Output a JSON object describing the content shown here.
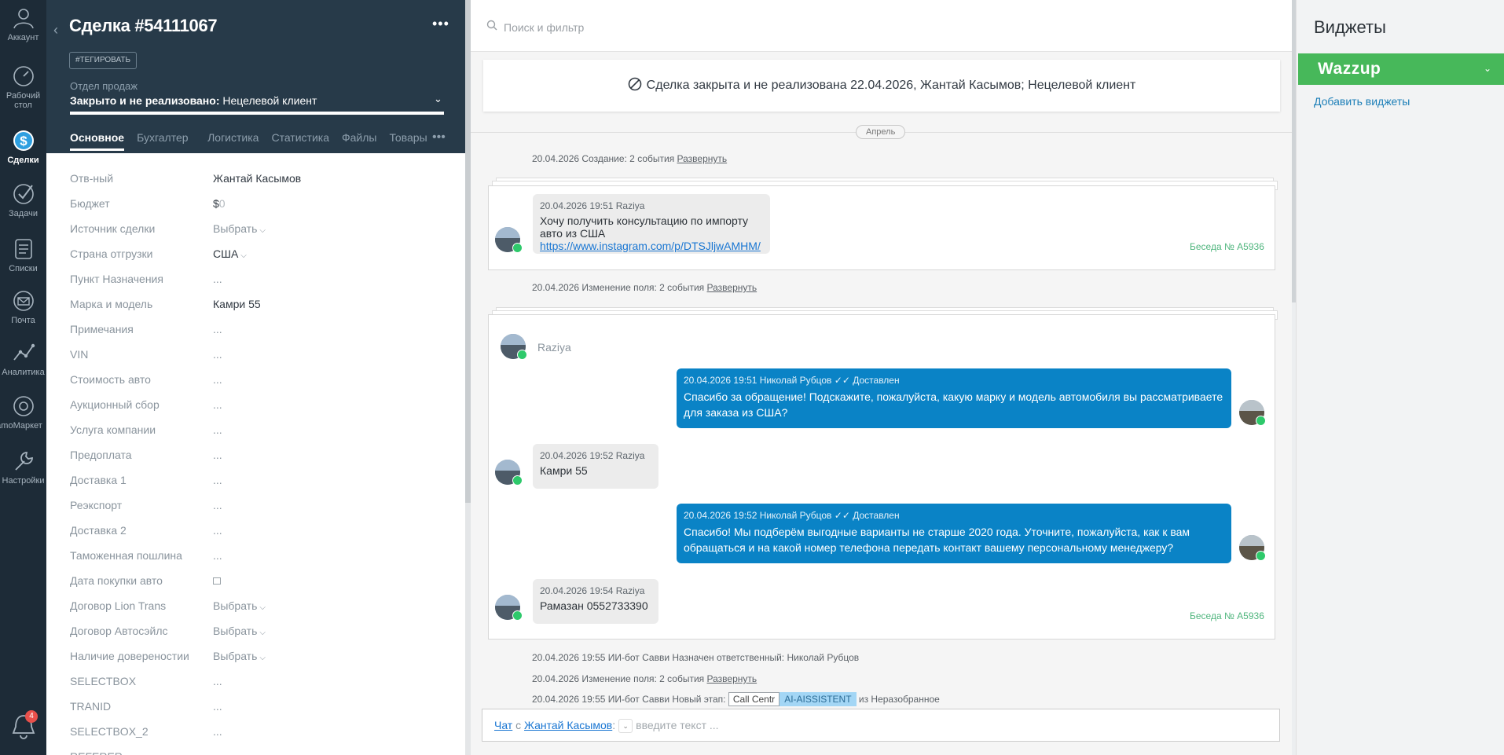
{
  "nav": {
    "items": [
      {
        "label": "Аккаунт",
        "icon": "account-icon"
      },
      {
        "label": "Рабочий стол",
        "icon": "dashboard-icon"
      },
      {
        "label": "Сделки",
        "icon": "deals-icon"
      },
      {
        "label": "Задачи",
        "icon": "tasks-icon"
      },
      {
        "label": "Списки",
        "icon": "lists-icon"
      },
      {
        "label": "Почта",
        "icon": "mail-icon"
      },
      {
        "label": "Аналитика",
        "icon": "analytics-icon"
      },
      {
        "label": "amoМаркет",
        "icon": "market-icon"
      },
      {
        "label": "Настройки",
        "icon": "settings-icon"
      }
    ],
    "notifications_count": "4"
  },
  "deal": {
    "title": "Сделка #54111067",
    "tag_button": "#ТЕГИРОВАТЬ",
    "pipeline_label": "Отдел продаж",
    "status_bold": "Закрыто и не реализовано:",
    "status_reason": " Нецелевой клиент",
    "more": "•••",
    "tabs": [
      "Основное",
      "Бухгалтер",
      "Логистика",
      "Статистика",
      "Файлы",
      "Товары"
    ],
    "tabs_more": "•••"
  },
  "fields": [
    {
      "label": "Отв-ный",
      "value": "Жантай Касымов",
      "kind": "text"
    },
    {
      "label": "Бюджет",
      "value": "$",
      "value_muted": "0",
      "kind": "budget"
    },
    {
      "label": "Источник сделки",
      "value": "Выбрать",
      "kind": "select"
    },
    {
      "label": "Страна отгрузки",
      "value": "США",
      "kind": "select"
    },
    {
      "label": "Пункт Назначения",
      "value": "...",
      "kind": "empty"
    },
    {
      "label": "Марка и модель",
      "value": "Камри 55",
      "kind": "text"
    },
    {
      "label": "Примечания",
      "value": "...",
      "kind": "empty"
    },
    {
      "label": "VIN",
      "value": "...",
      "kind": "empty"
    },
    {
      "label": "Стоимость авто",
      "value": "...",
      "kind": "empty"
    },
    {
      "label": "Аукционный сбор",
      "value": "...",
      "kind": "empty"
    },
    {
      "label": "Услуга компании",
      "value": "...",
      "kind": "empty"
    },
    {
      "label": "Предоплата",
      "value": "...",
      "kind": "empty"
    },
    {
      "label": "Доставка 1",
      "value": "...",
      "kind": "empty"
    },
    {
      "label": "Реэкспорт",
      "value": "...",
      "kind": "empty"
    },
    {
      "label": "Доставка 2",
      "value": "...",
      "kind": "empty"
    },
    {
      "label": "Таможенная пошлина",
      "value": "...",
      "kind": "empty"
    },
    {
      "label": "Дата покупки авто",
      "value": "",
      "kind": "date"
    },
    {
      "label": "Договор Lion Trans",
      "value": "Выбрать",
      "kind": "select"
    },
    {
      "label": "Договор Автосэйлс",
      "value": "Выбрать",
      "kind": "select"
    },
    {
      "label": "Наличие довереностии",
      "value": "Выбрать",
      "kind": "select"
    },
    {
      "label": "SELECTBOX",
      "value": "...",
      "kind": "empty"
    },
    {
      "label": "TRANID",
      "value": "...",
      "kind": "empty"
    },
    {
      "label": "SELECTBOX_2",
      "value": "...",
      "kind": "empty"
    },
    {
      "label": "REFERER",
      "value": "",
      "kind": "empty"
    }
  ],
  "feed": {
    "search_placeholder": "Поиск и фильтр",
    "closed_notice": "Сделка закрыта и не реализована 22.04.2026, Жантай Касымов; Нецелевой клиент",
    "month": "Апрель",
    "event1_text": "20.04.2026 Создание: 2 события ",
    "expand": "Развернуть",
    "msg1": {
      "meta": "20.04.2026 19:51 Raziya",
      "text": "Хочу получить консультацию по импорту авто из США",
      "link": "https://www.instagram.com/p/DTSJljwAMHM/"
    },
    "conv_number": "Беседа № A5936",
    "event2_text": "20.04.2026 Изменение поля: 2 события ",
    "sender": "Raziya",
    "out1": {
      "meta": "20.04.2026 19:51 Николай Рубцов",
      "status": "Доставлен",
      "text": "Спасибо за обращение! Подскажите, пожалуйста, какую марку и модель автомобиля вы рассматриваете для заказа из США?"
    },
    "in2": {
      "meta": "20.04.2026 19:52 Raziya",
      "text": "Камри 55"
    },
    "out2": {
      "meta": "20.04.2026 19:52 Николай Рубцов",
      "status": "Доставлен",
      "text": "Спасибо! Мы подберём выгодные варианты не старше 2020 года. Уточните, пожалуйста, как к вам обращаться и на какой номер телефона передать контакт вашему персональному менеджеру?"
    },
    "in3": {
      "meta": "20.04.2026 19:54 Raziya",
      "text": "Рамазан 0552733390"
    },
    "event3_text": "20.04.2026 19:55 ИИ-бот Савви Назначен ответственный: Николай Рубцов",
    "event4_text": "20.04.2026 Изменение поля: 2 события ",
    "event5_prefix": "20.04.2026 19:55 ИИ-бот Савви Новый этап: ",
    "stage_old": "Call Centr",
    "stage_new": "AI-AISSISTENT",
    "event5_suffix": " из Неразобранное",
    "chat": {
      "link1": "Чат",
      "with": " с ",
      "link2": "Жантай Касымов",
      "colon": ":",
      "placeholder": "введите текст ..."
    }
  },
  "widgets": {
    "title": "Виджеты",
    "wazzup": "Wazzup",
    "add": "Добавить виджеты"
  },
  "colors": {
    "nav_bg": "#1d2b37",
    "header_bg": "#273a49",
    "accent_blue": "#0a83c6",
    "wazzup_green": "#47b85a",
    "whatsapp_green": "#2ec96b"
  }
}
